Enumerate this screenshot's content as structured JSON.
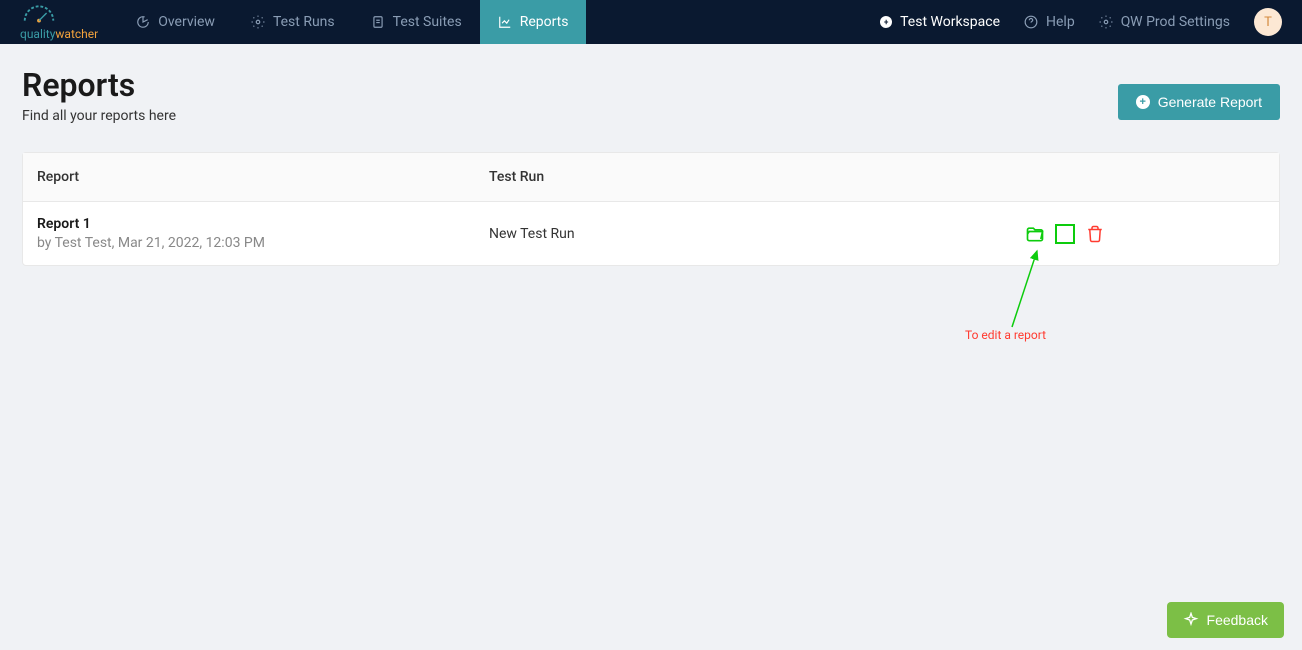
{
  "brand": {
    "name_part1": "quality",
    "name_part2": "watcher"
  },
  "nav": {
    "items": [
      {
        "label": "Overview"
      },
      {
        "label": "Test Runs"
      },
      {
        "label": "Test Suites"
      },
      {
        "label": "Reports"
      }
    ],
    "workspace": "Test Workspace",
    "help": "Help",
    "settings": "QW Prod Settings",
    "avatar": "T"
  },
  "page": {
    "title": "Reports",
    "subtitle": "Find all your reports here",
    "generate_btn": "Generate Report"
  },
  "table": {
    "headers": {
      "report": "Report",
      "testrun": "Test Run"
    },
    "rows": [
      {
        "name": "Report 1",
        "meta": "by Test Test, Mar 21, 2022, 12:03 PM",
        "testrun": "New Test Run"
      }
    ]
  },
  "annotation": {
    "text": "To edit a report"
  },
  "feedback": {
    "label": "Feedback"
  }
}
